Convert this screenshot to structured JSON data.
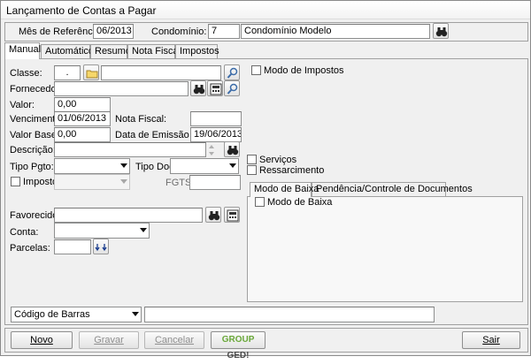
{
  "window": {
    "title": "Lançamento de Contas a Pagar"
  },
  "header": {
    "mes_label": "Mês de Referência:",
    "mes_value": "06/2013",
    "condominio_label": "Condomínio:",
    "condominio_code": "7",
    "condominio_name": "Condomínio Modelo"
  },
  "tabs": [
    {
      "label": "Manual",
      "active": true
    },
    {
      "label": "Automático"
    },
    {
      "label": "Resumo"
    },
    {
      "label": "Nota Fiscal"
    },
    {
      "label": "Impostos"
    }
  ],
  "form": {
    "classe_label": "Classe:",
    "classe_code": ".",
    "classe_desc": "",
    "fornecedor_label": "Fornecedor:",
    "fornecedor_value": "",
    "valor_label": "Valor:",
    "valor_value": "0,00",
    "vencimento_label": "Vencimento:",
    "vencimento_value": "01/06/2013",
    "nota_fiscal_label": "Nota Fiscal:",
    "nota_fiscal_value": "",
    "valor_base_label": "Valor Base:",
    "valor_base_value": "0,00",
    "data_emissao_label": "Data de Emissão NF:",
    "data_emissao_value": "19/06/2013",
    "descricao_label": "Descrição:",
    "descricao_value": "",
    "tipo_pgto_label": "Tipo Pgto:",
    "tipo_pgto_value": "",
    "tipo_doc_label": "Tipo Doc:",
    "tipo_doc_value": "",
    "imposto_label": "Imposto",
    "imposto_value": "",
    "fgts_label": "FGTS:",
    "fgts_value": "",
    "favorecido_label": "Favorecido:",
    "favorecido_value": "",
    "conta_label": "Conta:",
    "conta_value": "",
    "parcelas_label": "Parcelas:",
    "parcelas_value": ""
  },
  "right": {
    "modo_impostos_label": "Modo de Impostos",
    "servicos_label": "Serviços",
    "ressarcimento_label": "Ressarcimento",
    "subtabs": [
      {
        "label": "Modo de Baixa",
        "active": true
      },
      {
        "label": "Pendência/Controle de Documentos"
      }
    ],
    "modo_baixa_label": "Modo de Baixa"
  },
  "barcode": {
    "select_value": "Código de Barras",
    "input_value": ""
  },
  "buttons": {
    "novo": "Novo",
    "gravar": "Gravar",
    "cancelar": "Cancelar",
    "ged_group": "GROUP",
    "ged_ged": "GED",
    "sair": "Sair"
  },
  "colors": {
    "window_bg": "#f0f0f0",
    "ged_green": "#6aa83a"
  },
  "icons": [
    "search-binoculars-icon",
    "folder-icon",
    "magnifier-icon",
    "calculator-icon",
    "spin-arrows-icon",
    "double-down-arrow-icon"
  ]
}
